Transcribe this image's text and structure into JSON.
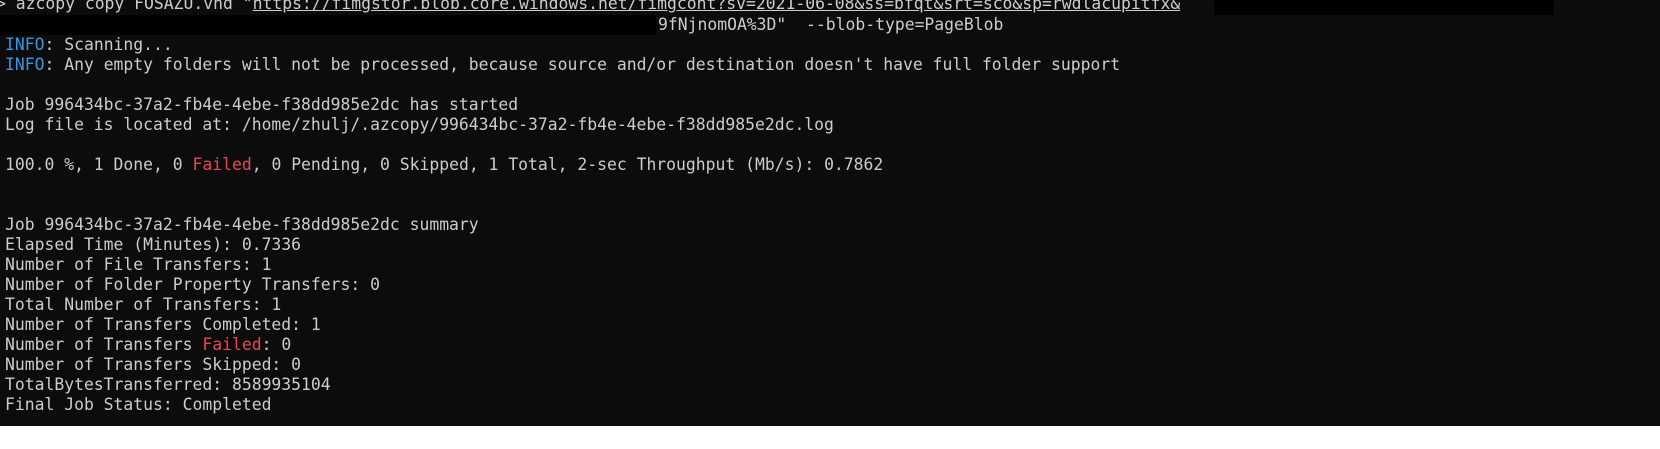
{
  "terminal": {
    "command": {
      "prompt": "> ",
      "text": "azcopy copy FOSAZU.vhd \"",
      "url": "https://fimgstor.blob.core.windows.net/fimgcont?sv=2021-06-08&ss=bfqt&srt=sco&sp=rwdlacupitfx&",
      "continuation": "9fNjnomOA%3D\"  --blob-type=PageBlob"
    },
    "info_lines": [
      {
        "tag": "INFO",
        "text": ": Scanning..."
      },
      {
        "tag": "INFO",
        "text": ": Any empty folders will not be processed, because source and/or destination doesn't have full folder support"
      }
    ],
    "job_started": "Job 996434bc-37a2-fb4e-4ebe-f38dd985e2dc has started",
    "log_file": "Log file is located at: /home/zhulj/.azcopy/996434bc-37a2-fb4e-4ebe-f38dd985e2dc.log",
    "progress": {
      "pre": "100.0 %, 1 Done, 0 ",
      "failed_word": "Failed",
      "post": ", 0 Pending, 0 Skipped, 1 Total, 2-sec Throughput (Mb/s): 0.7862"
    },
    "summary": {
      "header": "Job 996434bc-37a2-fb4e-4ebe-f38dd985e2dc summary",
      "elapsed": "Elapsed Time (Minutes): 0.7336",
      "file_transfers": "Number of File Transfers: 1",
      "folder_transfers": "Number of Folder Property Transfers: 0",
      "total_transfers": "Total Number of Transfers: 1",
      "completed": "Number of Transfers Completed: 1",
      "failed_pre": "Number of Transfers ",
      "failed_word": "Failed",
      "failed_post": ": 0",
      "skipped": "Number of Transfers Skipped: 0",
      "bytes": "TotalBytesTransferred: 8589935104",
      "final_status": "Final Job Status: Completed"
    }
  },
  "colors": {
    "background": "#0c0c0c",
    "text": "#cccccc",
    "info": "#3a96dd",
    "failed": "#e74856"
  }
}
